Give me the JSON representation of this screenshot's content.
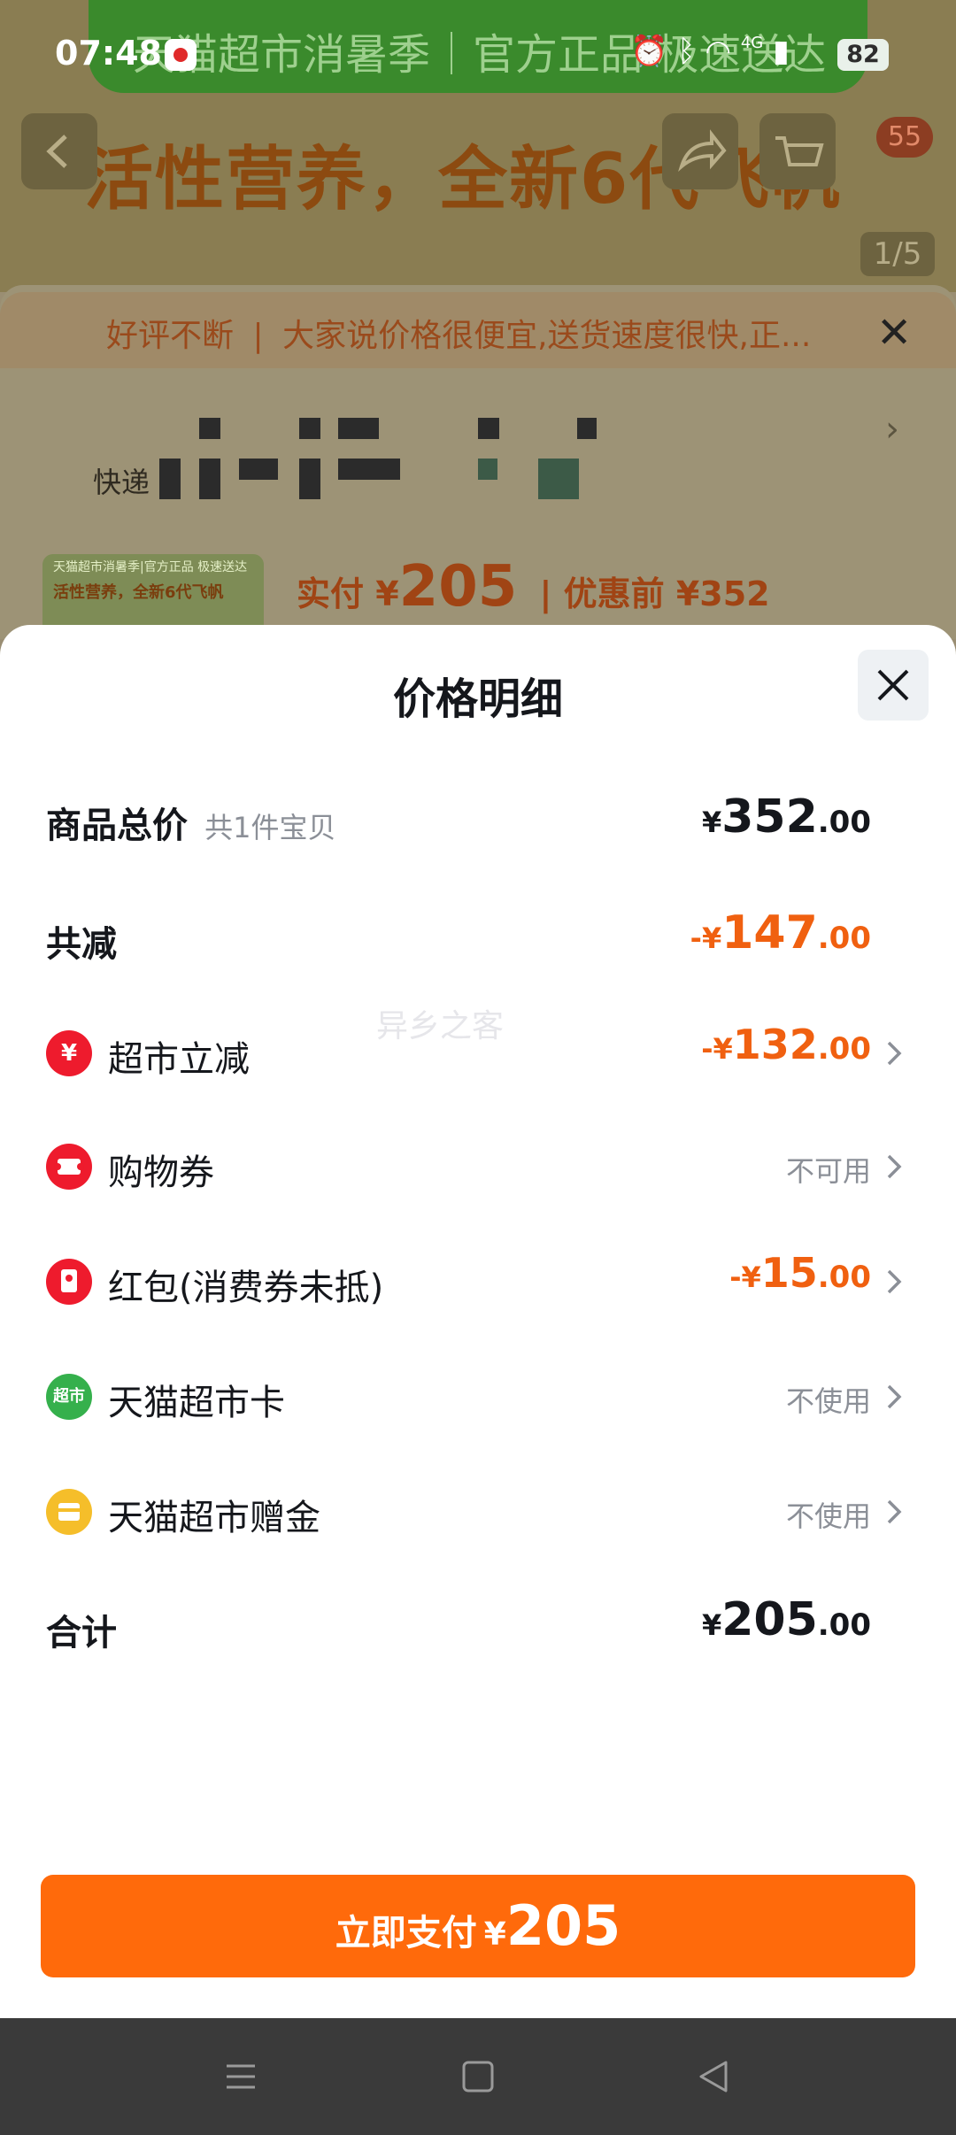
{
  "status_bar": {
    "time": "07:48",
    "network": "4G",
    "battery": "82"
  },
  "background": {
    "banner_text": "天猫超市消暑季｜官方正品 极速送达",
    "title_text": "活性营养，全新6代飞帆",
    "cart_badge": "55",
    "pager": "1/5",
    "notice_tag": "好评不断",
    "notice_text": "大家说价格很便宜,送货速度很快,正...",
    "delivery_label": "快递",
    "thumb_line1": "天猫超市消暑季|官方正品 极速送达",
    "thumb_line2": "活性营养，全新6代飞帆",
    "price_prefix": "实付 ¥",
    "price_value": "205",
    "price_before": "| 优惠前 ¥352"
  },
  "sheet": {
    "title": "价格明细",
    "rows": [
      {
        "label": "商品总价",
        "sub": "共1件宝贝",
        "prefix": "",
        "currency": "¥",
        "main": "352",
        "decimal": ".00"
      },
      {
        "label": "共减",
        "prefix": "-",
        "currency": "¥",
        "main": "147",
        "decimal": ".00"
      },
      {
        "label": "超市立减",
        "prefix": "-",
        "currency": "¥",
        "main": "132",
        "decimal": ".00",
        "icon": "yuan-discount-icon"
      },
      {
        "label": "购物券",
        "value": "不可用",
        "icon": "ticket-icon"
      },
      {
        "label": "红包(消费券未抵)",
        "prefix": "-",
        "currency": "¥",
        "main": "15",
        "decimal": ".00",
        "icon": "red-envelope-icon"
      },
      {
        "label": "天猫超市卡",
        "value": "不使用",
        "icon": "supermarket-card-icon",
        "icon_text": "超市"
      },
      {
        "label": "天猫超市赠金",
        "value": "不使用",
        "icon": "gift-money-icon"
      },
      {
        "label": "合计",
        "currency": "¥",
        "main": "205",
        "decimal": ".00"
      }
    ],
    "watermark": "异乡之客",
    "pay_button": {
      "label": "立即支付",
      "currency": "¥",
      "amount": "205"
    }
  },
  "colors": {
    "accent_orange": "#ff6a0b",
    "discount_orange": "#f06010",
    "icon_red": "#ee1b2d",
    "icon_green": "#35b04c",
    "icon_yellow": "#f5be2a"
  }
}
